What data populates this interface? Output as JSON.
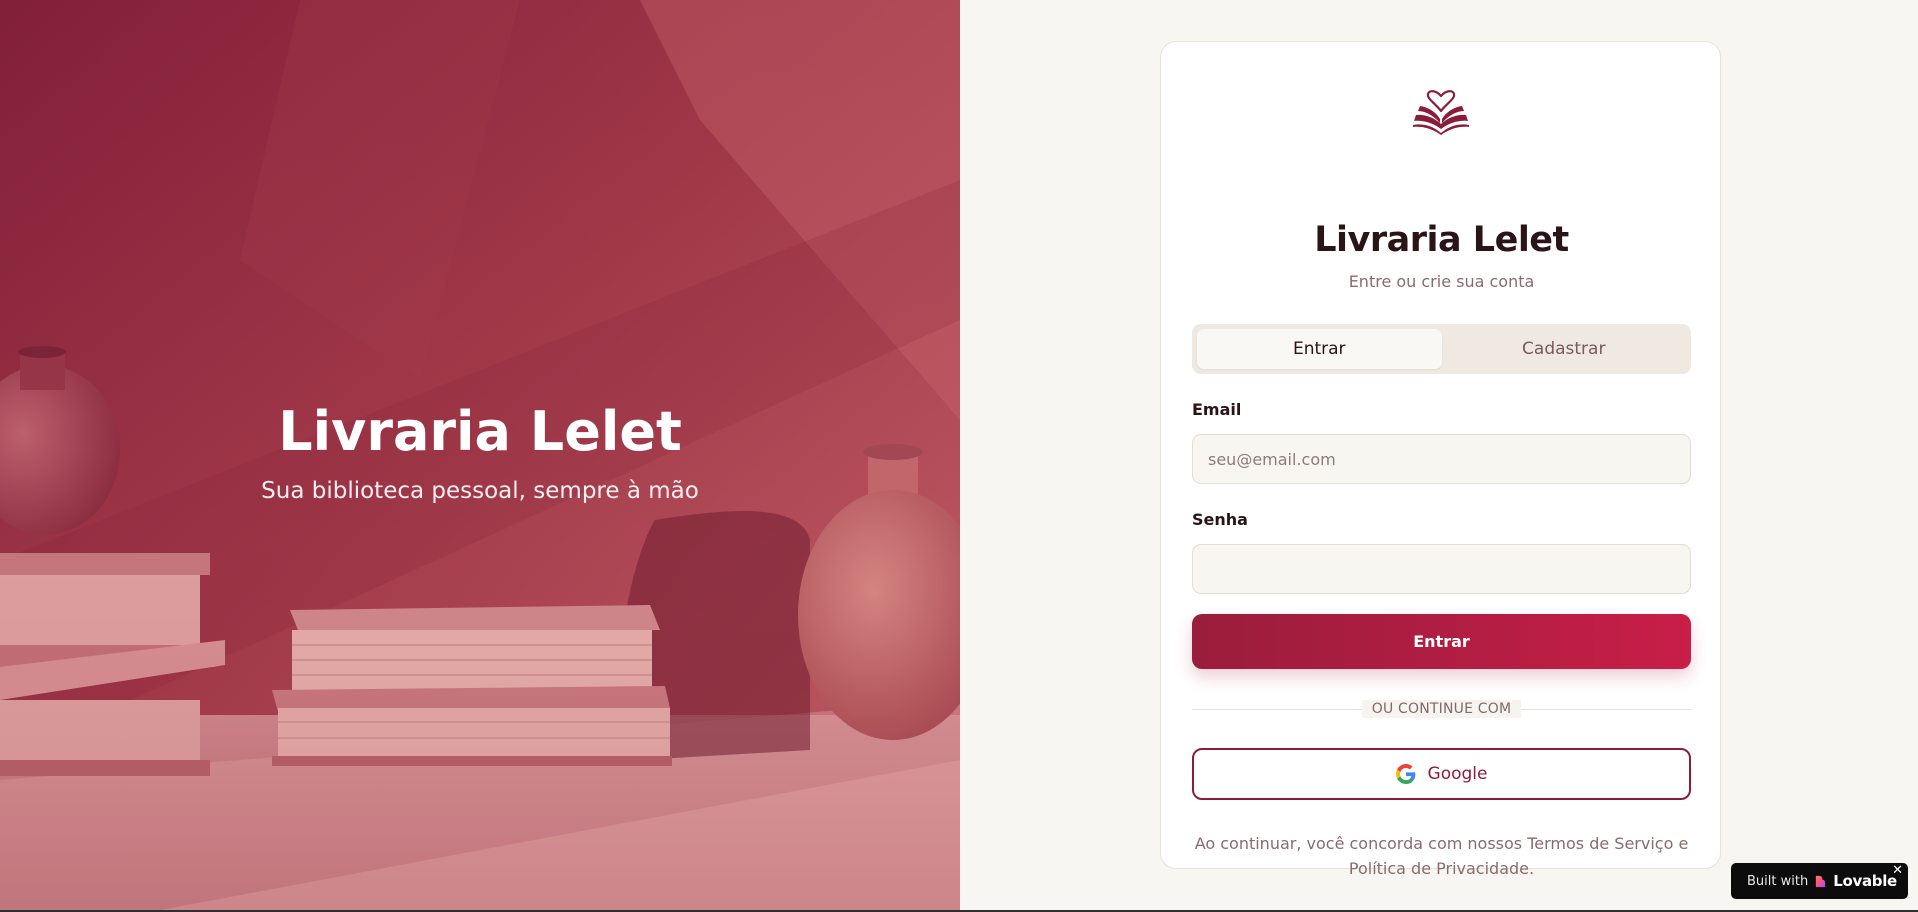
{
  "hero": {
    "title": "Livraria Lelet",
    "subtitle": "Sua biblioteca pessoal, sempre à mão"
  },
  "card": {
    "logo_icon": "book-heart-icon",
    "title": "Livraria Lelet",
    "subtitle": "Entre ou crie sua conta",
    "tabs": [
      {
        "label": "Entrar",
        "active": true
      },
      {
        "label": "Cadastrar",
        "active": false
      }
    ],
    "email": {
      "label": "Email",
      "placeholder": "seu@email.com",
      "value": ""
    },
    "password": {
      "label": "Senha",
      "placeholder": "",
      "value": ""
    },
    "submit_label": "Entrar",
    "divider_label": "OU CONTINUE COM",
    "google_label": "Google",
    "google_icon": "google-icon",
    "legal_text": "Ao continuar, você concorda com nossos Termos de Serviço e Política de Privacidade."
  },
  "badge": {
    "built_text": "Built with",
    "brand": "Lovable",
    "close_symbol": "✕"
  },
  "colors": {
    "brand": "#8c1d3a",
    "primary_gradient_start": "#9a1d3c",
    "primary_gradient_end": "#c81e48",
    "page_background": "#f8f6f2"
  }
}
